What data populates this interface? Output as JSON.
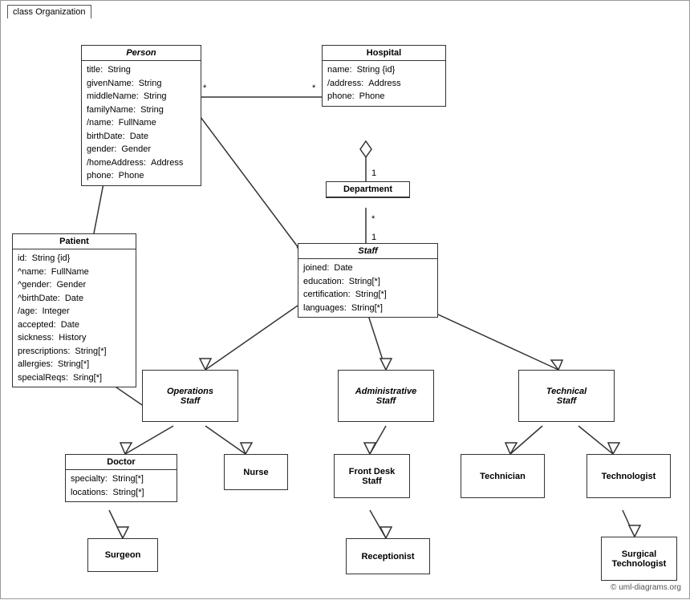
{
  "diagram": {
    "label": "class Organization",
    "copyright": "© uml-diagrams.org"
  },
  "boxes": {
    "person": {
      "title": "Person",
      "attrs": [
        {
          "name": "title:",
          "type": "String"
        },
        {
          "name": "givenName:",
          "type": "String"
        },
        {
          "name": "middleName:",
          "type": "String"
        },
        {
          "name": "familyName:",
          "type": "String"
        },
        {
          "name": "/name:",
          "type": "FullName"
        },
        {
          "name": "birthDate:",
          "type": "Date"
        },
        {
          "name": "gender:",
          "type": "Gender"
        },
        {
          "name": "/homeAddress:",
          "type": "Address"
        },
        {
          "name": "phone:",
          "type": "Phone"
        }
      ]
    },
    "hospital": {
      "title": "Hospital",
      "attrs": [
        {
          "name": "name:",
          "type": "String {id}"
        },
        {
          "name": "/address:",
          "type": "Address"
        },
        {
          "name": "phone:",
          "type": "Phone"
        }
      ]
    },
    "department": {
      "title": "Department"
    },
    "staff": {
      "title": "Staff",
      "attrs": [
        {
          "name": "joined:",
          "type": "Date"
        },
        {
          "name": "education:",
          "type": "String[*]"
        },
        {
          "name": "certification:",
          "type": "String[*]"
        },
        {
          "name": "languages:",
          "type": "String[*]"
        }
      ]
    },
    "patient": {
      "title": "Patient",
      "attrs": [
        {
          "name": "id:",
          "type": "String {id}"
        },
        {
          "name": "^name:",
          "type": "FullName"
        },
        {
          "name": "^gender:",
          "type": "Gender"
        },
        {
          "name": "^birthDate:",
          "type": "Date"
        },
        {
          "name": "/age:",
          "type": "Integer"
        },
        {
          "name": "accepted:",
          "type": "Date"
        },
        {
          "name": "sickness:",
          "type": "History"
        },
        {
          "name": "prescriptions:",
          "type": "String[*]"
        },
        {
          "name": "allergies:",
          "type": "String[*]"
        },
        {
          "name": "specialReqs:",
          "type": "Sring[*]"
        }
      ]
    },
    "operationsStaff": {
      "title": "Operations\nStaff",
      "italic": true
    },
    "administrativeStaff": {
      "title": "Administrative\nStaff",
      "italic": true
    },
    "technicalStaff": {
      "title": "Technical\nStaff",
      "italic": true
    },
    "doctor": {
      "title": "Doctor",
      "attrs": [
        {
          "name": "specialty:",
          "type": "String[*]"
        },
        {
          "name": "locations:",
          "type": "String[*]"
        }
      ]
    },
    "nurse": {
      "title": "Nurse"
    },
    "frontDeskStaff": {
      "title": "Front Desk\nStaff"
    },
    "technician": {
      "title": "Technician"
    },
    "technologist": {
      "title": "Technologist"
    },
    "surgeon": {
      "title": "Surgeon"
    },
    "receptionist": {
      "title": "Receptionist"
    },
    "surgicalTechnologist": {
      "title": "Surgical\nTechnologist"
    }
  }
}
